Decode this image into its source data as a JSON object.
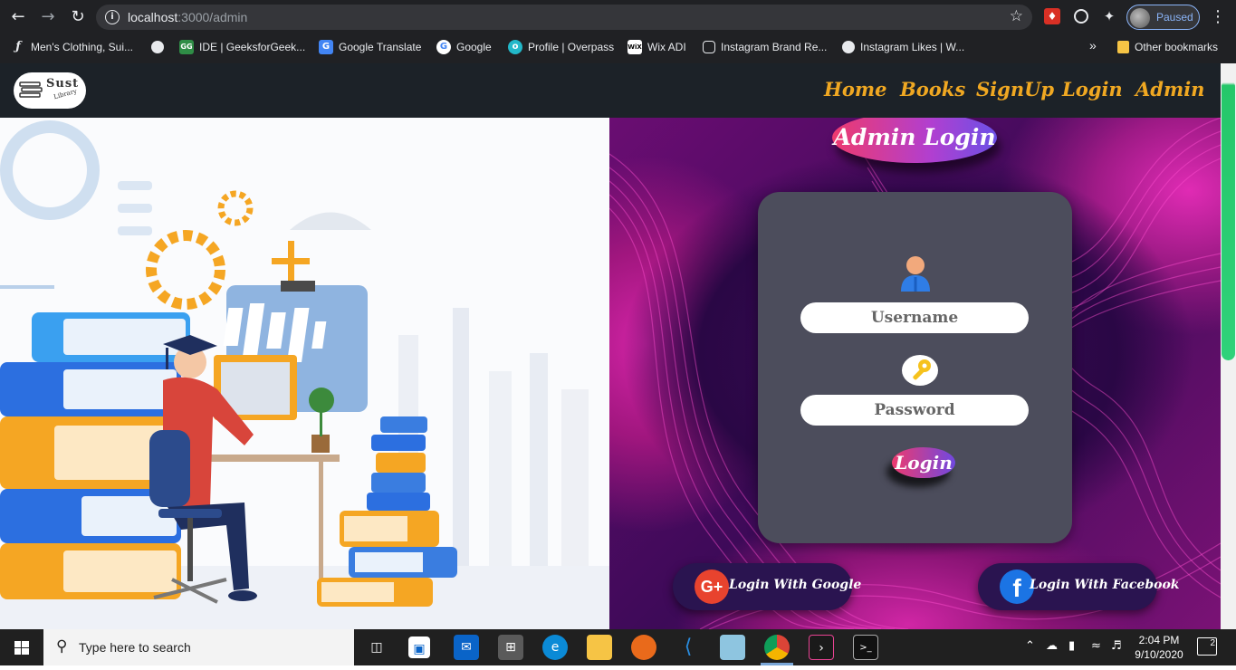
{
  "browser": {
    "url_host": "localhost",
    "url_path": ":3000/admin",
    "profile_status": "Paused",
    "bookmarks": [
      {
        "label": "Men's Clothing, Sui...",
        "icon": "bookmark-letter-icon"
      },
      {
        "label": "",
        "icon": "globe-icon"
      },
      {
        "label": "IDE | GeeksforGeek...",
        "icon": "gfg-icon"
      },
      {
        "label": "Google Translate",
        "icon": "translate-icon"
      },
      {
        "label": "Google",
        "icon": "google-icon"
      },
      {
        "label": "Profile | Overpass",
        "icon": "overpass-icon"
      },
      {
        "label": "Wix ADI",
        "icon": "wix-icon"
      },
      {
        "label": "Instagram Brand Re...",
        "icon": "instagram-icon"
      },
      {
        "label": "Instagram Likes | W...",
        "icon": "globe-icon"
      }
    ],
    "bookmarks_overflow": "»",
    "other_bookmarks": "Other bookmarks"
  },
  "site": {
    "logo_text": "Sust",
    "logo_sub": "Library",
    "nav": [
      "Home",
      "Books",
      "SignUp",
      "Login",
      "Admin"
    ]
  },
  "login": {
    "title": "Admin Login",
    "username_placeholder": "Username",
    "password_placeholder": "Password",
    "button": "Login",
    "google_label": "Login With Google",
    "facebook_label": "Login With Facebook",
    "google_icon_text": "G+",
    "facebook_icon_text": "f"
  },
  "taskbar": {
    "search_placeholder": "Type here to search",
    "time": "2:04 PM",
    "date": "9/10/2020",
    "notifications": "2"
  },
  "colors": {
    "nav_link": "#f0a822",
    "navbar_bg": "#1c2228",
    "card_bg": "#4c4d5c",
    "accent_pink": "#ee3a6e",
    "accent_purple": "#7048e0"
  }
}
